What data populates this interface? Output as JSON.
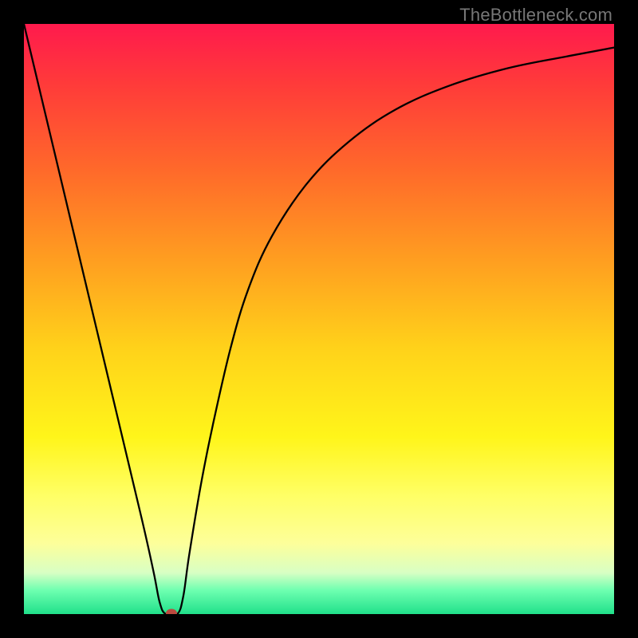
{
  "watermark": "TheBottleneck.com",
  "colors": {
    "marker": "#bb4a3f"
  },
  "chart_data": {
    "type": "line",
    "title": "",
    "xlabel": "",
    "ylabel": "",
    "xlim": [
      0,
      100
    ],
    "ylim": [
      0,
      100
    ],
    "grid": false,
    "legend": false,
    "series": [
      {
        "name": "bottleneck-curve",
        "x": [
          0,
          5,
          10,
          15,
          20,
          22,
          23,
          24,
          26,
          27,
          28,
          30,
          32,
          35,
          38,
          42,
          48,
          55,
          63,
          72,
          82,
          92,
          100
        ],
        "values": [
          100,
          79,
          58,
          37,
          16,
          7,
          2,
          0,
          0,
          3,
          10,
          22,
          32,
          45,
          55,
          64,
          73,
          80,
          85.5,
          89.5,
          92.5,
          94.5,
          96
        ]
      }
    ],
    "annotations": [
      {
        "name": "valley-marker",
        "x": 25,
        "y": 0
      }
    ],
    "background": "red-yellow-green vertical gradient (red top, green bottom)"
  }
}
